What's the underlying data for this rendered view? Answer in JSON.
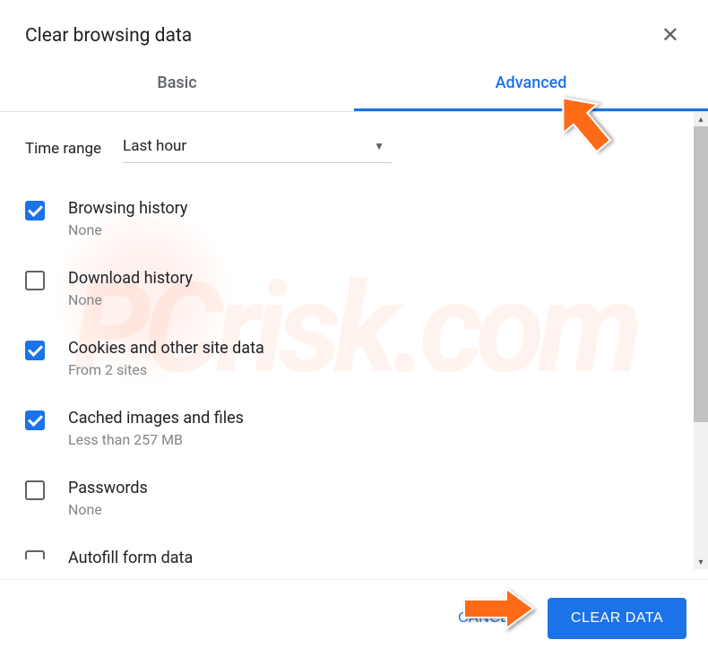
{
  "header": {
    "title": "Clear browsing data"
  },
  "tabs": {
    "basic": "Basic",
    "advanced": "Advanced"
  },
  "time_range": {
    "label": "Time range",
    "value": "Last hour"
  },
  "options": [
    {
      "title": "Browsing history",
      "sub": "None",
      "checked": true
    },
    {
      "title": "Download history",
      "sub": "None",
      "checked": false
    },
    {
      "title": "Cookies and other site data",
      "sub": "From 2 sites",
      "checked": true
    },
    {
      "title": "Cached images and files",
      "sub": "Less than 257 MB",
      "checked": true
    },
    {
      "title": "Passwords",
      "sub": "None",
      "checked": false
    },
    {
      "title": "Autofill form data",
      "sub": "",
      "checked": false
    }
  ],
  "footer": {
    "cancel": "CANCEL",
    "clear": "CLEAR DATA"
  }
}
